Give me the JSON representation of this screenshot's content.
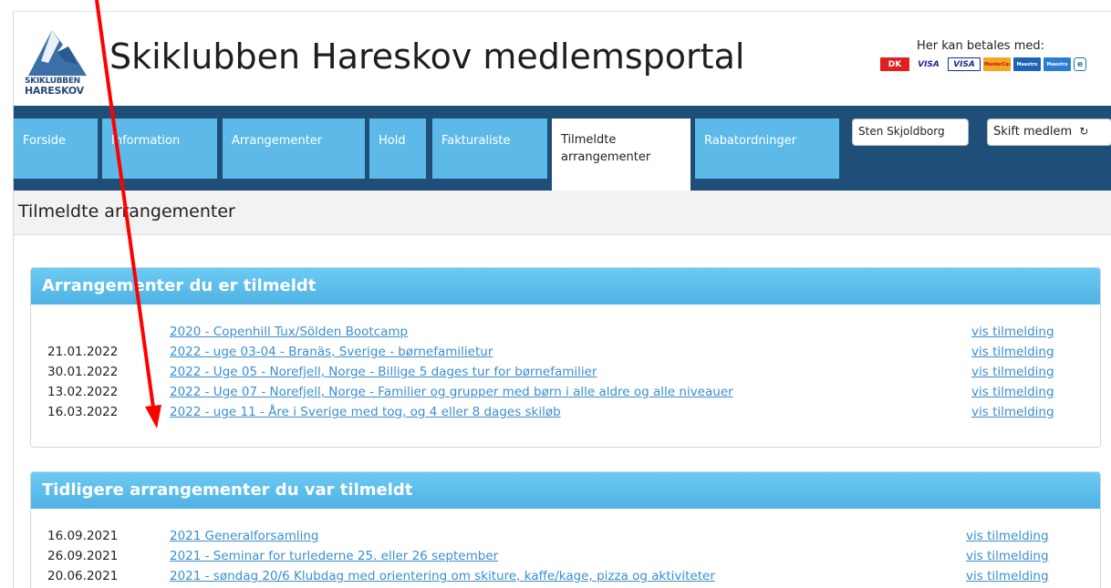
{
  "header": {
    "logo_text_line1": "SKIKLUBBEN",
    "logo_text_line2": "HARESKOV",
    "site_title": "Skiklubben Hareskov medlemsportal",
    "payment_label": "Her kan betales med:",
    "payment_methods": [
      "DK",
      "VISA",
      "VISA",
      "MasterCard",
      "Maestro",
      "Maestro",
      "e"
    ]
  },
  "nav": {
    "tabs": [
      "Forside",
      "Information",
      "Arrangementer",
      "Hold",
      "Fakturaliste",
      "Tilmeldte",
      "arrangementer",
      "Rabatordninger"
    ],
    "user_name": "Sten Skjoldborg",
    "switch_member": "Skift medlem",
    "switch_icon": "refresh-icon"
  },
  "page": {
    "title": "Tilmeldte arrangementer"
  },
  "current": {
    "heading": "Arrangementer du er tilmeldt",
    "rows": [
      {
        "date": "",
        "title": "2020 - Copenhill Tux/Sölden Bootcamp",
        "action": "vis tilmelding"
      },
      {
        "date": "21.01.2022",
        "title": "2022 - uge 03-04 - Branäs, Sverige - børnefamilietur",
        "action": "vis tilmelding"
      },
      {
        "date": "30.01.2022",
        "title": "2022 - Uge 05 - Norefjell, Norge - Billige 5 dages tur for børnefamilier",
        "action": "vis tilmelding"
      },
      {
        "date": "13.02.2022",
        "title": "2022 - Uge 07 - Norefjell, Norge - Familier og grupper med børn i alle aldre og alle niveauer",
        "action": "vis tilmelding"
      },
      {
        "date": "16.03.2022",
        "title": "2022 - uge 11 - Åre i Sverige med tog, og 4 eller 8 dages skiløb",
        "action": "vis tilmelding"
      }
    ]
  },
  "past": {
    "heading": "Tidligere arrangementer du var tilmeldt",
    "rows": [
      {
        "date": "16.09.2021",
        "title": "2021 Generalforsamling",
        "action": "vis tilmelding"
      },
      {
        "date": "26.09.2021",
        "title": "2021 - Seminar for turlederne 25. eller 26 september",
        "action": "vis tilmelding"
      },
      {
        "date": "20.06.2021",
        "title": "2021 - søndag 20/6 Klubdag med orientering om skiture, kaffe/kage, pizza og aktiviteter",
        "action": "vis tilmelding"
      }
    ]
  },
  "colors": {
    "nav_bg": "#1f4f79",
    "tab_bg": "#5dbae8",
    "panel_head": "#5cbdea",
    "link": "#3a8fd0",
    "annotation_arrow": "#ff0000"
  }
}
